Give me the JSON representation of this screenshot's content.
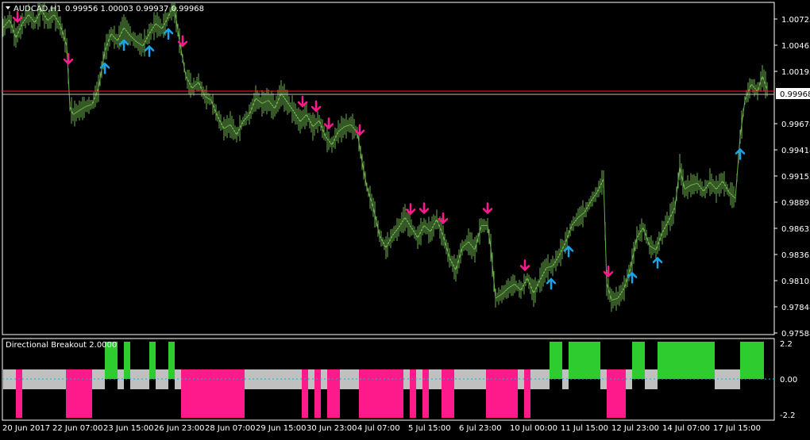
{
  "window": {
    "symbol_label": "AUDCAD,H1",
    "ohlc_label": "0.99956 1.00003 0.99937 0.99968"
  },
  "colors": {
    "background": "#000000",
    "candle": "#6ab04c",
    "up_arrow": "#1aa3e8",
    "down_arrow": "#ff1a8c",
    "price_line": "#ff2020",
    "histogram_up": "#2ecc2e",
    "histogram_down": "#ff1a8c",
    "histogram_neutral": "#c0c0c0",
    "axis": "#ffffff",
    "zero_line": "#00bcd4"
  },
  "price_axis": {
    "ticks": [
      "1.00723",
      "1.00463",
      "1.00195",
      "0.99678",
      "0.99418",
      "0.99153",
      "0.98893",
      "0.98633",
      "0.98363",
      "0.98103",
      "0.97848",
      "0.97588"
    ],
    "current_price_label": "0.99968"
  },
  "indicator": {
    "title": "Directional Breakout 2.0000",
    "axis_ticks": [
      "2.2",
      "0.00",
      "-2.2"
    ]
  },
  "time_axis": {
    "labels": [
      "20 Jun 2017",
      "22 Jun 07:00",
      "23 Jun 15:00",
      "26 Jun 23:00",
      "28 Jun 07:00",
      "29 Jun 15:00",
      "30 Jun 23:00",
      "4 Jul 07:00",
      "5 Jul 15:00",
      "6 Jul 23:00",
      "10 Jul 00:00",
      "11 Jul 15:00",
      "12 Jul 23:00",
      "14 Jul 07:00",
      "17 Jul 15:00"
    ]
  },
  "chart_data": {
    "type": "line",
    "series": [
      {
        "x": [
          0,
          8,
          16,
          24,
          32,
          40,
          48,
          56,
          64,
          72,
          80,
          84,
          88,
          96,
          104,
          112,
          120,
          128,
          136,
          144,
          152,
          160,
          168,
          176,
          184,
          192,
          200,
          208,
          214,
          218,
          222,
          230,
          238,
          246,
          254,
          262,
          270,
          278,
          286,
          294,
          302,
          310,
          318,
          326,
          334,
          342,
          350,
          358,
          366,
          374,
          382,
          390,
          398,
          406,
          414,
          422,
          430,
          438,
          446,
          452,
          458,
          466,
          474,
          482,
          490,
          498,
          506,
          514,
          522,
          530,
          538,
          546,
          554,
          562,
          570,
          578,
          586,
          594,
          602,
          610,
          614,
          620,
          628,
          636,
          644,
          652,
          660,
          668,
          676,
          684,
          692,
          700,
          708,
          716,
          724,
          732,
          740,
          748,
          756,
          760,
          766,
          774,
          782,
          790,
          798,
          806,
          814,
          822,
          830,
          838,
          846,
          852,
          858,
          866,
          874,
          882,
          890,
          898,
          906,
          914,
          922,
          928,
          934,
          942,
          950,
          956,
          962
        ],
        "y": [
          1.0058,
          1.0066,
          1.0048,
          1.0062,
          1.0071,
          1.0063,
          1.0076,
          1.0065,
          1.0071,
          1.006,
          1.004,
          0.998,
          0.9972,
          0.9976,
          0.998,
          0.9982,
          0.9998,
          1.0035,
          1.0052,
          1.0045,
          1.0058,
          1.005,
          1.0044,
          1.004,
          1.0052,
          1.0062,
          1.0057,
          1.0069,
          1.008,
          1.0066,
          1.0045,
          1.001,
          0.9998,
          1.0004,
          0.999,
          0.9986,
          0.997,
          0.9958,
          0.9962,
          0.9952,
          0.9965,
          0.9972,
          0.9988,
          0.9983,
          0.9986,
          0.9978,
          0.9993,
          0.9984,
          0.9975,
          0.9965,
          0.9972,
          0.996,
          0.9966,
          0.995,
          0.9942,
          0.9955,
          0.996,
          0.9962,
          0.9954,
          0.9925,
          0.99,
          0.988,
          0.9852,
          0.984,
          0.9852,
          0.986,
          0.987,
          0.986,
          0.985,
          0.9862,
          0.9856,
          0.9868,
          0.9852,
          0.983,
          0.9818,
          0.984,
          0.9846,
          0.9838,
          0.9862,
          0.9862,
          0.984,
          0.979,
          0.9794,
          0.98,
          0.9804,
          0.9798,
          0.981,
          0.9795,
          0.9808,
          0.982,
          0.9822,
          0.9832,
          0.9845,
          0.9862,
          0.987,
          0.9875,
          0.9886,
          0.9895,
          0.9908,
          0.9805,
          0.9788,
          0.979,
          0.98,
          0.982,
          0.985,
          0.986,
          0.9842,
          0.9838,
          0.9855,
          0.9867,
          0.988,
          0.992,
          0.9898,
          0.9902,
          0.9904,
          0.9896,
          0.9905,
          0.9898,
          0.9906,
          0.9895,
          0.9889,
          0.995,
          0.9986,
          1.0002,
          0.9995,
          1.001,
          0.9997
        ]
      }
    ],
    "up_arrows_x": [
      132,
      156,
      188,
      212,
      716,
      694,
      796,
      828,
      932
    ],
    "down_arrows_x": [
      22,
      86,
      230,
      381,
      398,
      414,
      453,
      517,
      534,
      558,
      614,
      661,
      766
    ],
    "histogram": {
      "values": [
        {
          "x": 4,
          "w": 16,
          "v": 0.5
        },
        {
          "x": 20,
          "w": 8,
          "v": -2.2
        },
        {
          "x": 28,
          "w": 55,
          "v": 0.5
        },
        {
          "x": 83,
          "w": 33,
          "v": -2.2
        },
        {
          "x": 116,
          "w": 16,
          "v": 0.5
        },
        {
          "x": 132,
          "w": 16,
          "v": 2.2
        },
        {
          "x": 148,
          "w": 8,
          "v": 0.5
        },
        {
          "x": 156,
          "w": 8,
          "v": 2.2
        },
        {
          "x": 164,
          "w": 24,
          "v": 0.5
        },
        {
          "x": 188,
          "w": 8,
          "v": 2.2
        },
        {
          "x": 196,
          "w": 16,
          "v": 0.5
        },
        {
          "x": 212,
          "w": 8,
          "v": 2.2
        },
        {
          "x": 220,
          "w": 8,
          "v": 0.5
        },
        {
          "x": 228,
          "w": 80,
          "v": -2.2
        },
        {
          "x": 308,
          "w": 72,
          "v": 0.5
        },
        {
          "x": 380,
          "w": 8,
          "v": -2.2
        },
        {
          "x": 388,
          "w": 8,
          "v": 0.5
        },
        {
          "x": 396,
          "w": 8,
          "v": -2.2
        },
        {
          "x": 404,
          "w": 8,
          "v": 0.5
        },
        {
          "x": 412,
          "w": 16,
          "v": -2.2
        },
        {
          "x": 428,
          "w": 24,
          "v": 0.5
        },
        {
          "x": 452,
          "w": 56,
          "v": -2.2
        },
        {
          "x": 508,
          "w": 8,
          "v": 0.5
        },
        {
          "x": 516,
          "w": 8,
          "v": -2.2
        },
        {
          "x": 524,
          "w": 8,
          "v": 0.5
        },
        {
          "x": 532,
          "w": 8,
          "v": -2.2
        },
        {
          "x": 540,
          "w": 16,
          "v": 0.5
        },
        {
          "x": 556,
          "w": 16,
          "v": -2.2
        },
        {
          "x": 572,
          "w": 40,
          "v": 0.5
        },
        {
          "x": 612,
          "w": 40,
          "v": -2.2
        },
        {
          "x": 652,
          "w": 8,
          "v": 0.5
        },
        {
          "x": 660,
          "w": 8,
          "v": -2.2
        },
        {
          "x": 668,
          "w": 24,
          "v": 0.5
        },
        {
          "x": 692,
          "w": 16,
          "v": 2.2
        },
        {
          "x": 708,
          "w": 8,
          "v": 0.5
        },
        {
          "x": 716,
          "w": 40,
          "v": 2.2
        },
        {
          "x": 756,
          "w": 8,
          "v": 0.5
        },
        {
          "x": 764,
          "w": 24,
          "v": -2.2
        },
        {
          "x": 788,
          "w": 8,
          "v": 0.5
        },
        {
          "x": 796,
          "w": 16,
          "v": 2.2
        },
        {
          "x": 812,
          "w": 16,
          "v": 0.5
        },
        {
          "x": 828,
          "w": 72,
          "v": 2.2
        },
        {
          "x": 900,
          "w": 32,
          "v": 0.5
        },
        {
          "x": 932,
          "w": 30,
          "v": 2.2
        }
      ],
      "ylim": [
        -2.2,
        2.2
      ]
    },
    "ylim": [
      0.97548,
      1.00823
    ]
  }
}
